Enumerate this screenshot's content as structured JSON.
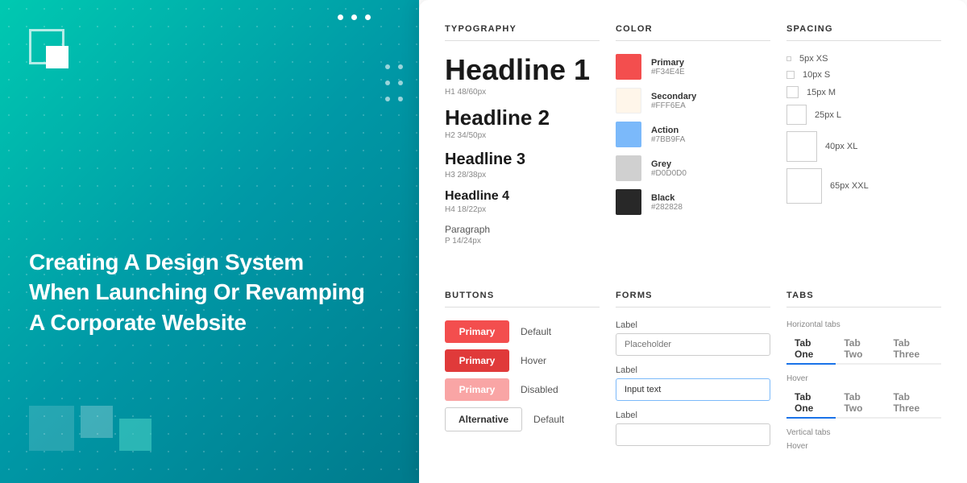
{
  "left": {
    "hero_title": "Creating A Design System\nWhen Launching Or Revamping\nA Corporate Website"
  },
  "right": {
    "sections": {
      "typography": {
        "label": "TYPOGRAPHY",
        "items": [
          {
            "text": "Headline 1",
            "class": "type-h1",
            "sub": "H1 48/60px"
          },
          {
            "text": "Headline 2",
            "class": "type-h2",
            "sub": "H2 34/50px"
          },
          {
            "text": "Headline 3",
            "class": "type-h3",
            "sub": "H3 28/38px"
          },
          {
            "text": "Headline 4",
            "class": "type-h4",
            "sub": "H4 18/22px"
          },
          {
            "text": "Paragraph",
            "class": "type-p",
            "sub": "P 14/24px"
          }
        ]
      },
      "color": {
        "label": "COLOR",
        "items": [
          {
            "name": "Primary",
            "hex": "#F34E4E",
            "bg": "#F34E4E"
          },
          {
            "name": "Secondary",
            "hex": "#FFF6EA",
            "bg": "#FFF6EA",
            "border": "#eee"
          },
          {
            "name": "Action",
            "hex": "#7BB9FA",
            "bg": "#7BB9FA"
          },
          {
            "name": "Grey",
            "hex": "#D0D0D0",
            "bg": "#D0D0D0"
          },
          {
            "name": "Black",
            "hex": "#282828",
            "bg": "#282828"
          }
        ]
      },
      "spacing": {
        "label": "SPACING",
        "items": [
          {
            "label": "5px XS",
            "size": 6
          },
          {
            "label": "10px S",
            "size": 10
          },
          {
            "label": "15px M",
            "size": 15
          },
          {
            "label": "25px L",
            "size": 25
          },
          {
            "label": "40px XL",
            "size": 40
          },
          {
            "label": "65px XXL",
            "size": 46
          }
        ]
      },
      "buttons": {
        "label": "BUTTONS",
        "rows": [
          {
            "text": "Primary",
            "variant": "primary",
            "state": "default",
            "state_label": "Default"
          },
          {
            "text": "Primary",
            "variant": "primary-hover",
            "state": "hover",
            "state_label": "Hover"
          },
          {
            "text": "Primary",
            "variant": "primary-disabled",
            "state": "disabled",
            "state_label": "Disabled"
          },
          {
            "text": "Alternative",
            "variant": "alternative",
            "state": "default",
            "state_label": "Default"
          }
        ]
      },
      "forms": {
        "label": "FORMS",
        "items": [
          {
            "label": "Label",
            "placeholder": "Placeholder",
            "value": "",
            "active": false
          },
          {
            "label": "Label",
            "placeholder": "",
            "value": "Input text",
            "active": true
          },
          {
            "label": "Label",
            "placeholder": "",
            "value": "",
            "active": false
          }
        ]
      },
      "tabs": {
        "label": "TABS",
        "horizontal": {
          "label": "Horizontal tabs",
          "items": [
            "Tab One",
            "Tab Two",
            "Tab Three"
          ]
        },
        "horizontal_hover": {
          "label": "Hover",
          "items": [
            "Tab One",
            "Tab Two",
            "Tab Three"
          ]
        },
        "vertical": {
          "label": "Vertical tabs",
          "hover_label": "Hover"
        }
      }
    }
  }
}
